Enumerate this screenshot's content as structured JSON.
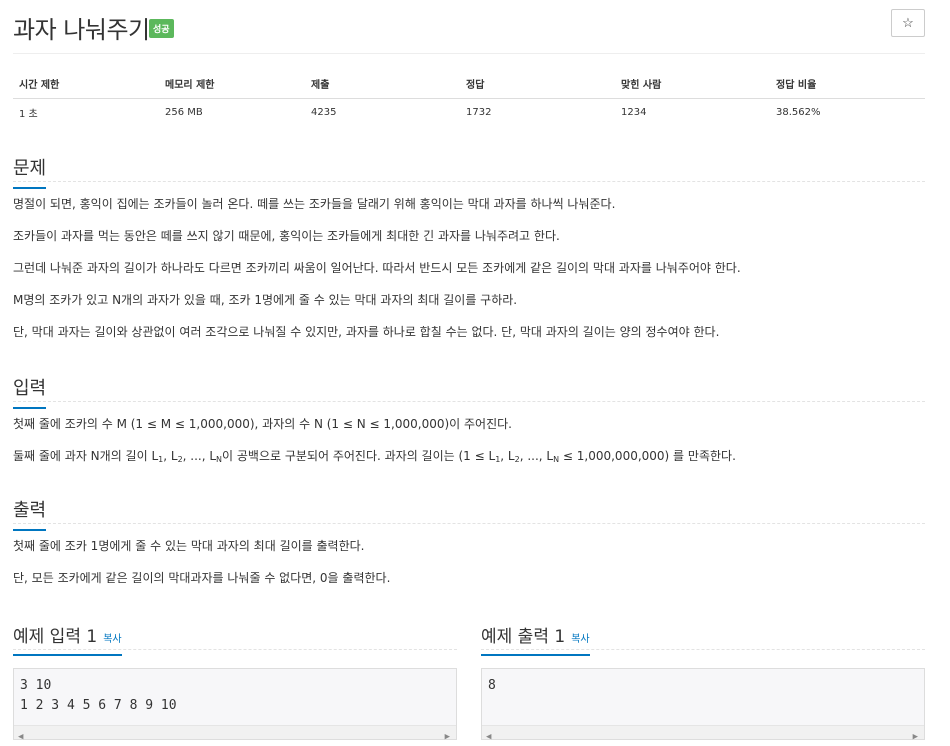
{
  "header": {
    "title": "과자 나눠주기",
    "badge": "성공",
    "star_icon": "☆"
  },
  "info": {
    "headers": [
      "시간 제한",
      "메모리 제한",
      "제출",
      "정답",
      "맞힌 사람",
      "정답 비율"
    ],
    "values": [
      "1 초",
      "256 MB",
      "4235",
      "1732",
      "1234",
      "38.562%"
    ]
  },
  "problem": {
    "title": "문제",
    "p1": "명절이 되면, 홍익이 집에는 조카들이 놀러 온다. 떼를 쓰는 조카들을 달래기 위해 홍익이는 막대 과자를 하나씩 나눠준다.",
    "p2": "조카들이 과자를 먹는 동안은 떼를 쓰지 않기 때문에, 홍익이는 조카들에게 최대한 긴 과자를 나눠주려고 한다.",
    "p3": "그런데 나눠준 과자의 길이가 하나라도 다르면 조카끼리 싸움이 일어난다. 따라서 반드시 모든 조카에게 같은 길이의 막대 과자를 나눠주어야 한다.",
    "p4": "M명의 조카가 있고 N개의 과자가 있을 때, 조카 1명에게 줄 수 있는 막대 과자의 최대 길이를 구하라.",
    "p5": "단, 막대 과자는 길이와 상관없이 여러 조각으로 나눠질 수 있지만, 과자를 하나로 합칠 수는 없다. 단, 막대 과자의 길이는 양의 정수여야 한다."
  },
  "input": {
    "title": "입력",
    "p1": "첫째 줄에 조카의 수 M (1 ≤ M ≤ 1,000,000), 과자의 수 N (1 ≤ N ≤ 1,000,000)이 주어진다.",
    "p2_pre": "둘째 줄에 과자 N개의 길이 L",
    "p2_s1": "1",
    "p2_c1": ", L",
    "p2_s2": "2",
    "p2_c2": ", ..., L",
    "p2_sN": "N",
    "p2_mid": "이 공백으로 구분되어 주어진다. 과자의 길이는 (1 ≤ L",
    "p2_c3": ", L",
    "p2_c4": ", ..., L",
    "p2_post": " ≤ 1,000,000,000) 를 만족한다."
  },
  "output": {
    "title": "출력",
    "p1": "첫째 줄에 조카 1명에게 줄 수 있는 막대 과자의 최대 길이를 출력한다.",
    "p2": "단, 모든 조카에게 같은 길이의 막대과자를 나눠줄 수 없다면, 0을 출력한다."
  },
  "sample_input": {
    "title": "예제 입력 1",
    "copy": "복사",
    "code": "3 10\n1 2 3 4 5 6 7 8 9 10"
  },
  "sample_output": {
    "title": "예제 출력 1",
    "copy": "복사",
    "code": "8"
  },
  "scroll": {
    "left": "◀",
    "right": "▶"
  }
}
